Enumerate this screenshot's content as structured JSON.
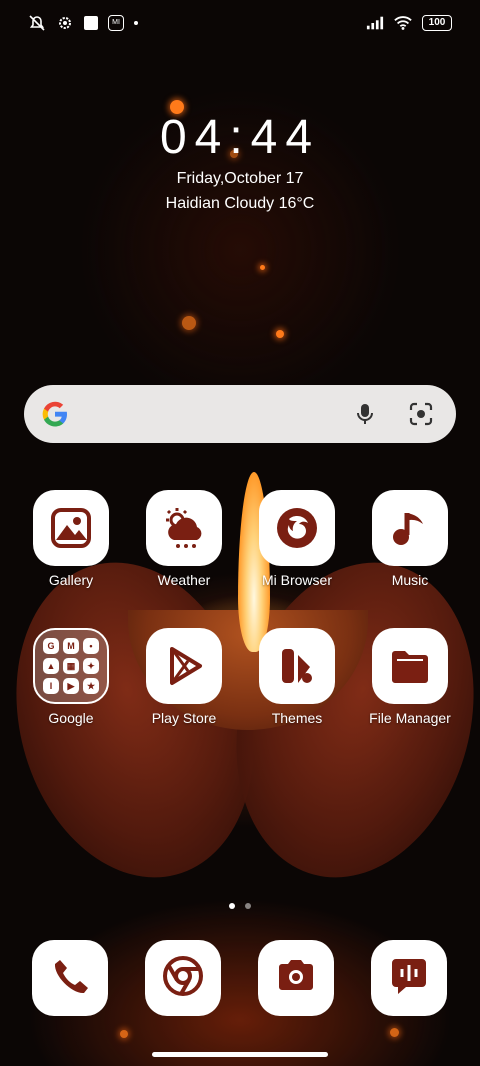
{
  "status_bar": {
    "left_icons": [
      "vibrate-silent-icon",
      "settings-gear-icon",
      "notification-square-icon",
      "mi-icon",
      "dot-icon"
    ],
    "right_icons": [
      "signal-icon",
      "wifi-icon",
      "battery-icon"
    ],
    "battery": "100",
    "mi_label": "MI"
  },
  "lockscreen": {
    "time": "04:44",
    "date": "Friday,October 17",
    "weather": "Haidian Cloudy 16°C"
  },
  "search_bar": {
    "icons": [
      "google-g-icon",
      "microphone-icon",
      "google-lens-icon"
    ]
  },
  "accent_color": "#7a1f12",
  "apps": [
    {
      "label": "Gallery",
      "icon": "gallery-icon"
    },
    {
      "label": "Weather",
      "icon": "weather-icon"
    },
    {
      "label": "Mi Browser",
      "icon": "browser-icon"
    },
    {
      "label": "Music",
      "icon": "music-note-icon"
    },
    {
      "label": "Google",
      "icon": "folder-icon"
    },
    {
      "label": "Play Store",
      "icon": "play-store-icon"
    },
    {
      "label": "Themes",
      "icon": "themes-icon"
    },
    {
      "label": "File Manager",
      "icon": "folder-file-icon"
    }
  ],
  "folder_mini": [
    "G",
    "M",
    "•",
    "▲",
    "▦",
    "✦",
    "I",
    "▶",
    "★"
  ],
  "pager": {
    "pages": 2,
    "active": 1
  },
  "dock": [
    {
      "icon": "phone-icon"
    },
    {
      "icon": "chrome-icon"
    },
    {
      "icon": "camera-icon"
    },
    {
      "icon": "messages-icon"
    }
  ]
}
